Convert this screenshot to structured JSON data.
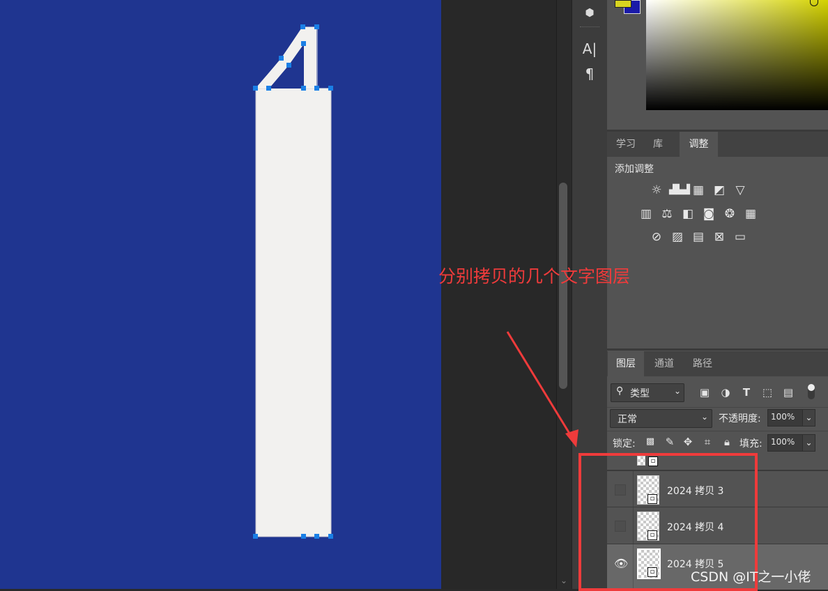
{
  "annotation": {
    "text": "分别拷贝的几个文字图层",
    "color": "#ef3b3b"
  },
  "watermark": "CSDN @IT之一小佬",
  "canvas": {
    "background": "#1f3590",
    "shape_fill": "#f2f1ef",
    "anchor_color": "#1a7fe6"
  },
  "tools": [
    {
      "name": "3d-cube-icon",
      "glyph": "⬢"
    },
    {
      "name": "character-panel-icon",
      "glyph": "A|"
    },
    {
      "name": "paragraph-panel-icon",
      "glyph": "¶"
    }
  ],
  "adjust_panel": {
    "tabs": [
      "学习",
      "库",
      "调整"
    ],
    "active_tab": "调整",
    "heading": "添加调整",
    "icon_rows": [
      [
        "brightness-icon",
        "levels-icon",
        "curves-icon",
        "exposure-icon",
        "vibrance-icon"
      ],
      [
        "hue-saturation-icon",
        "color-balance-icon",
        "black-white-icon",
        "photo-filter-icon",
        "channel-mixer-icon",
        "color-lookup-icon"
      ],
      [
        "invert-icon",
        "posterize-icon",
        "threshold-icon",
        "selective-color-icon",
        "gradient-map-icon"
      ]
    ]
  },
  "layers_panel": {
    "tabs": [
      "图层",
      "通道",
      "路径"
    ],
    "active_tab": "图层",
    "filter_label": "类型",
    "blend_mode": "正常",
    "opacity_label": "不透明度:",
    "opacity_value": "100%",
    "lock_label": "锁定:",
    "fill_label": "填充:",
    "fill_value": "100%",
    "layers": [
      {
        "name": "2024 拷贝 3",
        "visible": false,
        "selected": false
      },
      {
        "name": "2024 拷贝 4",
        "visible": false,
        "selected": false
      },
      {
        "name": "2024 拷贝 5",
        "visible": true,
        "selected": true
      }
    ]
  }
}
